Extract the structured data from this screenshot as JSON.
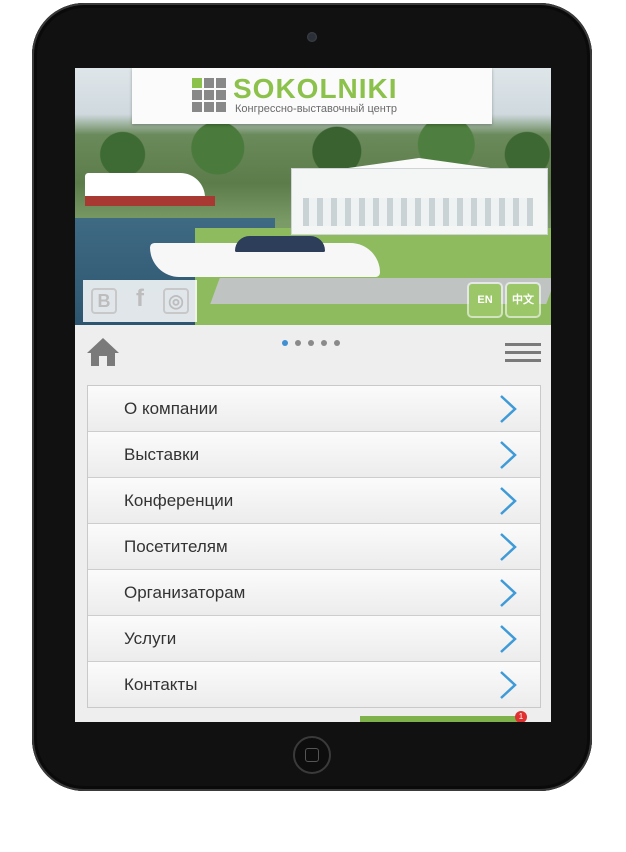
{
  "header": {
    "brand": "SOKOLNIKI",
    "subtitle": "Конгрессно-выставочный центр"
  },
  "social": {
    "icons": [
      "vk-icon",
      "facebook-icon",
      "instagram-icon"
    ],
    "vk_glyph": "B",
    "fb_glyph": "f",
    "ig_glyph": "◎"
  },
  "languages": [
    "EN",
    "中文"
  ],
  "slider": {
    "count": 5,
    "active_index": 0
  },
  "menu": {
    "items": [
      {
        "label": "О компании"
      },
      {
        "label": "Выставки"
      },
      {
        "label": "Конференции"
      },
      {
        "label": "Посетителям"
      },
      {
        "label": "Организаторам"
      },
      {
        "label": "Услуги"
      },
      {
        "label": "Контакты"
      }
    ]
  },
  "notification": {
    "count": "1"
  },
  "colors": {
    "brand_green": "#8cc24b",
    "accent_blue": "#3f9ad8",
    "lang_bg": "#9cc768"
  }
}
